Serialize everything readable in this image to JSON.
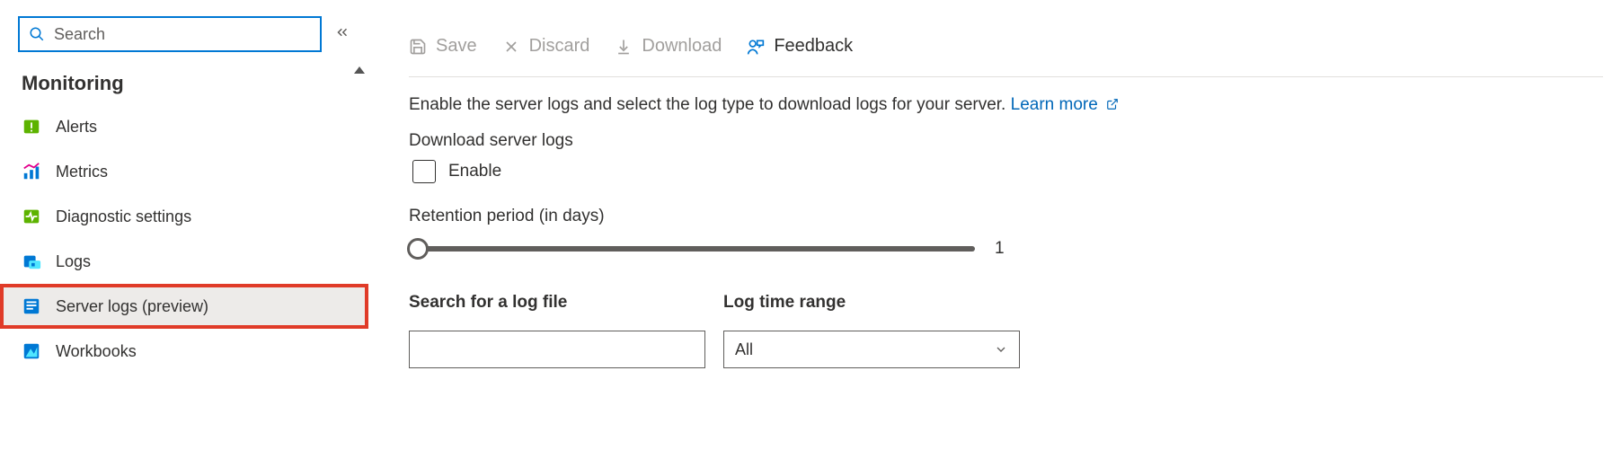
{
  "sidebar": {
    "search_placeholder": "Search",
    "section_title": "Monitoring",
    "items": [
      {
        "label": "Alerts",
        "icon": "alerts"
      },
      {
        "label": "Metrics",
        "icon": "metrics"
      },
      {
        "label": "Diagnostic settings",
        "icon": "diagnostics"
      },
      {
        "label": "Logs",
        "icon": "logs"
      },
      {
        "label": "Server logs (preview)",
        "icon": "serverlogs",
        "selected": true
      },
      {
        "label": "Workbooks",
        "icon": "workbooks"
      }
    ]
  },
  "toolbar": {
    "save": "Save",
    "discard": "Discard",
    "download": "Download",
    "feedback": "Feedback"
  },
  "main": {
    "description_text": "Enable the server logs and select the log type to download logs for your server.",
    "learn_more": "Learn more",
    "download_label": "Download server logs",
    "enable_label": "Enable",
    "retention_label": "Retention period (in days)",
    "retention_value": "1",
    "search_label": "Search for a log file",
    "search_value": "",
    "range_label": "Log time range",
    "range_value": "All"
  }
}
